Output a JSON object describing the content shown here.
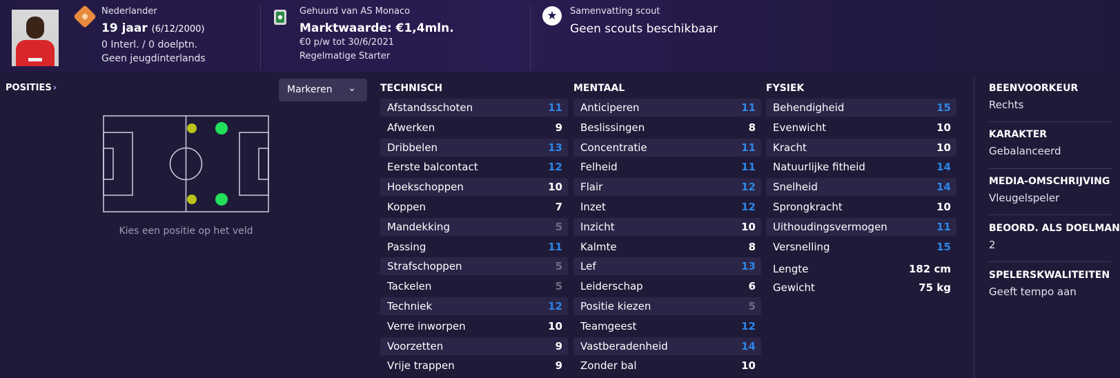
{
  "header": {
    "nationality": "Nederlander",
    "age": "19 jaar",
    "birthdate": "(6/12/2000)",
    "caps": "0 Interl. / 0 doelptn.",
    "youth": "Geen jeugdinterlands",
    "loan": "Gehuurd van AS Monaco",
    "value": "Marktwaarde: €1,4mln.",
    "wage": "€0 p/w tot 30/6/2021",
    "role": "Regelmatige Starter",
    "scout_title": "Samenvatting scout",
    "scout_text": "Geen scouts beschikbaar"
  },
  "positions": {
    "title": "POSITIES",
    "markeren": "Markeren",
    "hint": "Kies een positie op het veld"
  },
  "technisch": {
    "title": "TECHNISCH",
    "attrs": [
      {
        "name": "Afstandsschoten",
        "value": "11",
        "level": "high"
      },
      {
        "name": "Afwerken",
        "value": "9",
        "level": "mid"
      },
      {
        "name": "Dribbelen",
        "value": "13",
        "level": "high"
      },
      {
        "name": "Eerste balcontact",
        "value": "12",
        "level": "high"
      },
      {
        "name": "Hoekschoppen",
        "value": "10",
        "level": "mid"
      },
      {
        "name": "Koppen",
        "value": "7",
        "level": "mid"
      },
      {
        "name": "Mandekking",
        "value": "5",
        "level": "low"
      },
      {
        "name": "Passing",
        "value": "11",
        "level": "high"
      },
      {
        "name": "Strafschoppen",
        "value": "5",
        "level": "low"
      },
      {
        "name": "Tackelen",
        "value": "5",
        "level": "low"
      },
      {
        "name": "Techniek",
        "value": "12",
        "level": "high"
      },
      {
        "name": "Verre inworpen",
        "value": "10",
        "level": "mid"
      },
      {
        "name": "Voorzetten",
        "value": "9",
        "level": "mid"
      },
      {
        "name": "Vrije trappen",
        "value": "9",
        "level": "mid"
      }
    ]
  },
  "mentaal": {
    "title": "MENTAAL",
    "attrs": [
      {
        "name": "Anticiperen",
        "value": "11",
        "level": "high"
      },
      {
        "name": "Beslissingen",
        "value": "8",
        "level": "mid"
      },
      {
        "name": "Concentratie",
        "value": "11",
        "level": "high"
      },
      {
        "name": "Felheid",
        "value": "11",
        "level": "high"
      },
      {
        "name": "Flair",
        "value": "12",
        "level": "high"
      },
      {
        "name": "Inzet",
        "value": "12",
        "level": "high"
      },
      {
        "name": "Inzicht",
        "value": "10",
        "level": "mid"
      },
      {
        "name": "Kalmte",
        "value": "8",
        "level": "mid"
      },
      {
        "name": "Lef",
        "value": "13",
        "level": "high"
      },
      {
        "name": "Leiderschap",
        "value": "6",
        "level": "mid"
      },
      {
        "name": "Positie kiezen",
        "value": "5",
        "level": "low"
      },
      {
        "name": "Teamgeest",
        "value": "12",
        "level": "high"
      },
      {
        "name": "Vastberadenheid",
        "value": "14",
        "level": "high"
      },
      {
        "name": "Zonder bal",
        "value": "10",
        "level": "mid"
      }
    ]
  },
  "fysiek": {
    "title": "FYSIEK",
    "attrs": [
      {
        "name": "Behendigheid",
        "value": "15",
        "level": "high"
      },
      {
        "name": "Evenwicht",
        "value": "10",
        "level": "mid"
      },
      {
        "name": "Kracht",
        "value": "10",
        "level": "mid"
      },
      {
        "name": "Natuurlijke fitheid",
        "value": "14",
        "level": "high"
      },
      {
        "name": "Snelheid",
        "value": "14",
        "level": "high"
      },
      {
        "name": "Sprongkracht",
        "value": "10",
        "level": "mid"
      },
      {
        "name": "Uithoudingsvermogen",
        "value": "11",
        "level": "high"
      },
      {
        "name": "Versnelling",
        "value": "15",
        "level": "high"
      }
    ],
    "length_label": "Lengte",
    "length_value": "182 cm",
    "weight_label": "Gewicht",
    "weight_value": "75 kg"
  },
  "info": [
    {
      "title": "BEENVOORKEUR",
      "value": "Rechts"
    },
    {
      "title": "KARAKTER",
      "value": "Gebalanceerd"
    },
    {
      "title": "MEDIA-OMSCHRIJVING",
      "value": "Vleugelspeler"
    },
    {
      "title": "BEOORD. ALS DOELMAN",
      "value": "2"
    },
    {
      "title": "SPELERSKWALITEITEN",
      "value": "Geeft tempo aan"
    }
  ],
  "colors": {
    "background": "#1f1a38",
    "high": "#2d86e5",
    "low": "#6f6b82",
    "natural_position": "#22e05a",
    "accomplished_position": "#b9c41c"
  }
}
